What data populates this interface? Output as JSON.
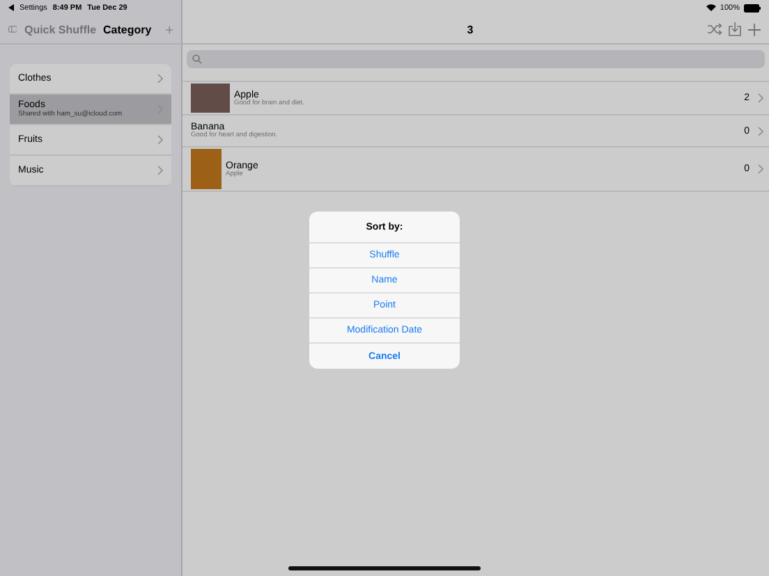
{
  "status_bar": {
    "back_app": "Settings",
    "time": "8:49 PM",
    "date": "Tue Dec 29",
    "battery": "100%"
  },
  "sidebar": {
    "back_title": "Quick Shuffle",
    "title": "Category",
    "items": [
      {
        "title": "Clothes",
        "selected": false
      },
      {
        "title": "Foods",
        "subtitle": "Shared with ham_su@icloud.com",
        "selected": true
      },
      {
        "title": "Fruits",
        "selected": false
      },
      {
        "title": "Music",
        "selected": false
      }
    ]
  },
  "main": {
    "title": "3",
    "rows": [
      {
        "kind": "landscape-photo",
        "name": "Apple",
        "subtitle": "Good for brain and diet.",
        "count": "2"
      },
      {
        "kind": "text",
        "name": "Banana",
        "subtitle": "Good for heart and digestion.",
        "count": "0"
      },
      {
        "kind": "portrait-photo",
        "name": "Orange",
        "subtitle": "Apple",
        "count": "0"
      }
    ]
  },
  "sort_dialog": {
    "title": "Sort by:",
    "options": [
      "Shuffle",
      "Name",
      "Point",
      "Modification Date"
    ],
    "cancel": "Cancel"
  }
}
